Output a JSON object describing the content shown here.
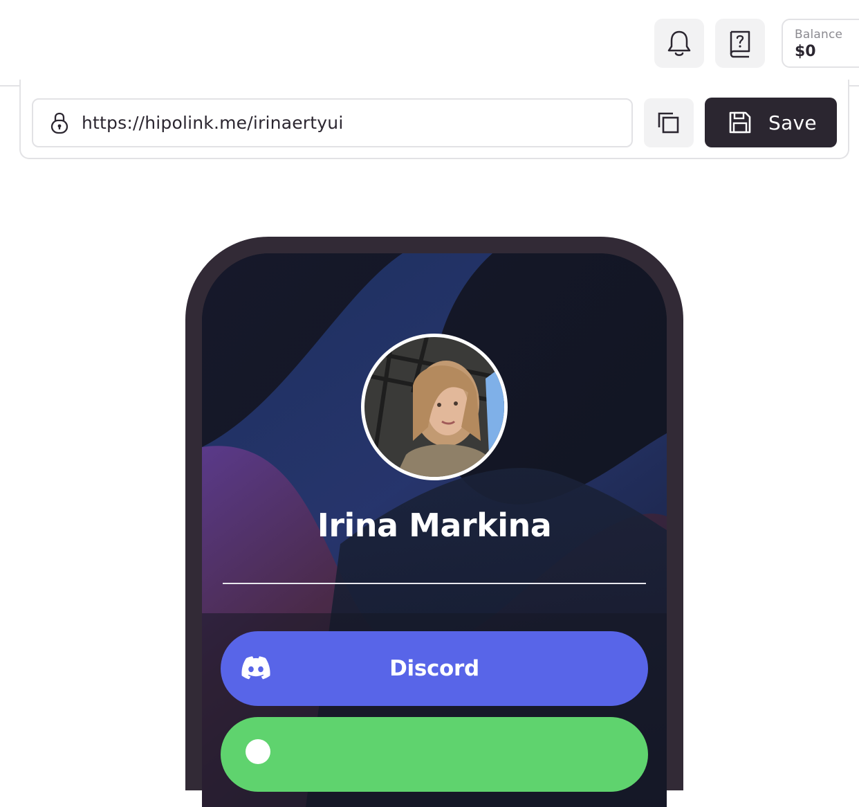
{
  "header": {
    "notifications_icon": "bell-icon",
    "help_icon": "help-book-icon",
    "balance": {
      "label": "Balance",
      "value": "$0"
    }
  },
  "url_bar": {
    "lock_icon": "lock-icon",
    "url": "https://hipolink.me/irinaertyui",
    "copy_icon": "copy-icon",
    "save_icon": "floppy-disk-icon",
    "save_label": "Save"
  },
  "preview": {
    "profile_name": "Irina Markina",
    "avatar": "profile-photo",
    "links": [
      {
        "label": "Discord",
        "icon": "discord-icon",
        "color": "#5865e8"
      },
      {
        "label": "",
        "icon": "link-icon",
        "color": "#5fd36e"
      }
    ]
  },
  "colors": {
    "primary_dark": "#2b2630",
    "phone_frame": "#322a36",
    "discord": "#5865e8",
    "green": "#5fd36e"
  }
}
